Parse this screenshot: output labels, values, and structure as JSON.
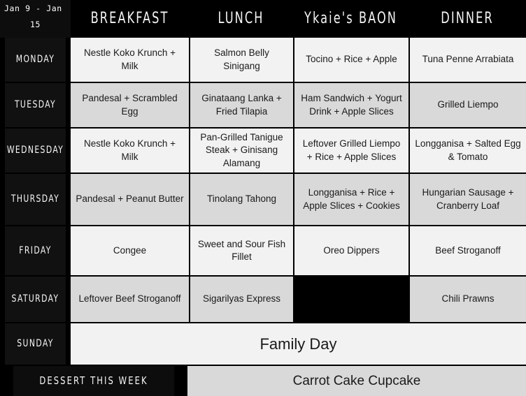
{
  "planner": {
    "date_range": {
      "line1": "Jan 9 - Jan",
      "line2": "15"
    },
    "columns": [
      {
        "key": "breakfast",
        "label": "BREAKFAST"
      },
      {
        "key": "lunch",
        "label": "LUNCH"
      },
      {
        "key": "baon",
        "label": "Ykaie's BAON"
      },
      {
        "key": "dinner",
        "label": "DINNER"
      }
    ],
    "rows": [
      {
        "day": "MONDAY",
        "breakfast": "Nestle Koko Krunch + Milk",
        "lunch": "Salmon Belly Sinigang",
        "baon": "Tocino + Rice + Apple",
        "dinner": "Tuna Penne Arrabiata"
      },
      {
        "day": "TUESDAY",
        "breakfast": "Pandesal + Scrambled Egg",
        "lunch": "Ginataang Lanka + Fried Tilapia",
        "baon": "Ham Sandwich + Yogurt Drink + Apple Slices",
        "dinner": "Grilled Liempo"
      },
      {
        "day": "WEDNESDAY",
        "breakfast": "Nestle Koko Krunch + Milk",
        "lunch": "Pan-Grilled Tanigue Steak + Ginisang Alamang",
        "baon": "Leftover Grilled Liempo + Rice + Apple Slices",
        "dinner": "Longganisa + Salted Egg & Tomato"
      },
      {
        "day": "THURSDAY",
        "breakfast": "Pandesal + Peanut Butter",
        "lunch": "Tinolang Tahong",
        "baon": "Longganisa + Rice + Apple Slices + Cookies",
        "dinner": "Hungarian Sausage + Cranberry Loaf"
      },
      {
        "day": "FRIDAY",
        "breakfast": "Congee",
        "lunch": "Sweet and Sour Fish Fillet",
        "baon": "Oreo Dippers",
        "dinner": "Beef Stroganoff"
      },
      {
        "day": "SATURDAY",
        "breakfast": "Leftover Beef Stroganoff",
        "lunch": "Sigarilyas Express",
        "baon": "",
        "dinner": "Chili Prawns"
      }
    ],
    "sunday": {
      "day": "SUNDAY",
      "note": "Family Day"
    },
    "dessert": {
      "label": "DESSERT THIS WEEK",
      "value": "Carrot Cake Cupcake"
    }
  }
}
